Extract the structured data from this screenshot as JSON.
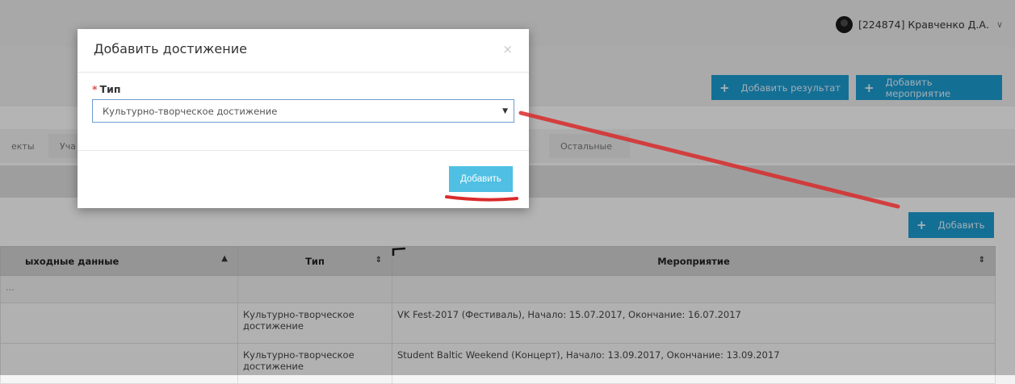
{
  "user": {
    "label": "[224874] Кравченко Д.А."
  },
  "header": {
    "buttons": [
      {
        "label": "Добавить результат"
      },
      {
        "label": "Добавить мероприятие"
      }
    ]
  },
  "tabs": [
    {
      "label": "екты"
    },
    {
      "label": "Уча"
    },
    {
      "label": "Остальные"
    }
  ],
  "add_button": {
    "label": "Добавить"
  },
  "table": {
    "columns": [
      "ыходные данные",
      "Тип",
      "Мероприятие"
    ],
    "filter_row": [
      "...",
      "",
      ""
    ],
    "rows": [
      {
        "cells": [
          "",
          "Культурно-творческое достижение",
          "VK Fest-2017 (Фестиваль), Начало: 15.07.2017, Окончание: 16.07.2017"
        ]
      },
      {
        "cells": [
          "",
          "Культурно-творческое достижение",
          "Student Baltic Weekend (Концерт), Начало: 13.09.2017, Окончание: 13.09.2017"
        ]
      }
    ]
  },
  "modal": {
    "title": "Добавить достижение",
    "close": "×",
    "field_label": "Тип",
    "required_mark": "*",
    "select_value": "Культурно-творческое достижение",
    "submit_label": "Добавить"
  },
  "colors": {
    "primary_button": "#1c9acf",
    "submit_button": "#4fbfe3",
    "annotation": "#d92b2b"
  },
  "icons": {
    "plus": "+",
    "chevron_down": "∨",
    "caret": "▼",
    "sort": "⇕"
  }
}
